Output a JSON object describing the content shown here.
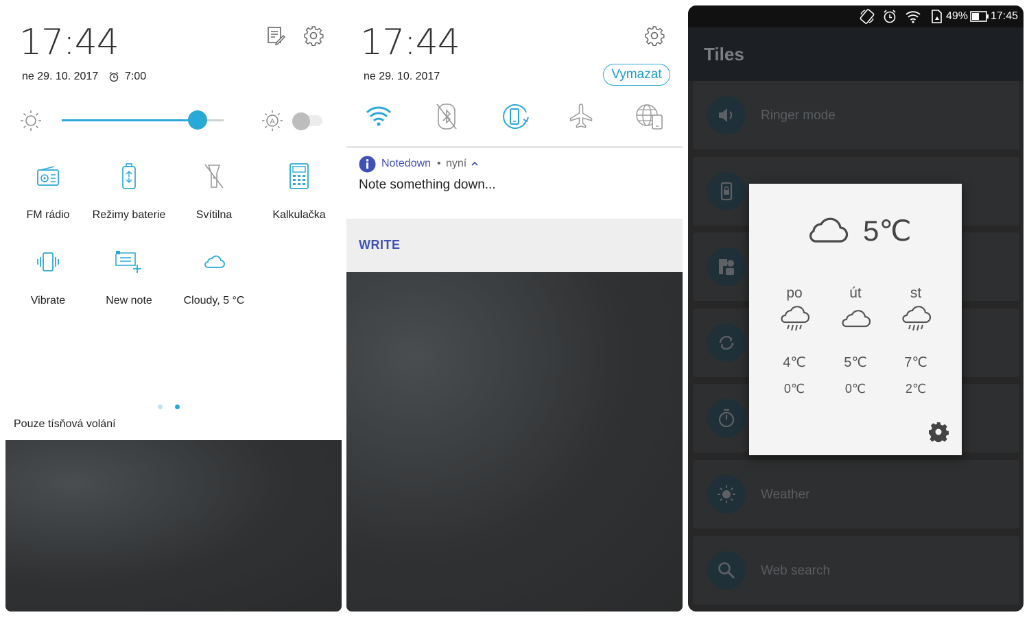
{
  "panel1": {
    "clock": "17:44",
    "date": "ne 29. 10. 2017",
    "alarm_time": "7:00",
    "brightness_percent": 84,
    "auto_brightness_on": false,
    "tiles": [
      {
        "label": "FM rádio",
        "icon": "radio-icon"
      },
      {
        "label": "Režimy baterie",
        "icon": "battery-mode-icon"
      },
      {
        "label": "Svítilna",
        "icon": "flashlight-off-icon"
      },
      {
        "label": "Kalkulačka",
        "icon": "calculator-icon"
      },
      {
        "label": "Vibrate",
        "icon": "vibrate-icon"
      },
      {
        "label": "New note",
        "icon": "new-note-icon"
      },
      {
        "label": "Cloudy, 5 °C",
        "icon": "cloud-icon"
      }
    ],
    "page_count": 2,
    "active_page": 2,
    "emergency_text": "Pouze tísňová volání"
  },
  "panel2": {
    "clock": "17:44",
    "date": "ne 29. 10. 2017",
    "clear_label": "Vymazat",
    "toggles": [
      "wifi-icon",
      "bluetooth-off-icon",
      "auto-rotate-icon",
      "airplane-mode-icon",
      "mobile-data-icon"
    ],
    "notification": {
      "app": "Notedown",
      "separator": "•",
      "time": "nyní",
      "text": "Note something down...",
      "action": "WRITE"
    }
  },
  "panel3": {
    "status": {
      "battery": "49%",
      "time": "17:45"
    },
    "title": "Tiles",
    "rows": [
      {
        "label": "Ringer mode",
        "icon": "volume-icon"
      },
      {
        "label": "",
        "icon": "lock-screen-icon"
      },
      {
        "label": "",
        "icon": "shapes-icon"
      },
      {
        "label": "",
        "icon": "sync-icon"
      },
      {
        "label": "",
        "icon": "timer-icon"
      },
      {
        "label": "Weather",
        "icon": "sun-icon"
      },
      {
        "label": "Web search",
        "icon": "search-icon"
      }
    ],
    "weather": {
      "current_temp": "5℃",
      "current_icon": "cloud-icon",
      "forecast": [
        {
          "day": "po",
          "icon": "rain-icon",
          "high": "4℃",
          "low": "0℃"
        },
        {
          "day": "út",
          "icon": "cloud-icon",
          "high": "5℃",
          "low": "0℃"
        },
        {
          "day": "st",
          "icon": "rain-icon",
          "high": "7℃",
          "low": "2℃"
        }
      ]
    }
  },
  "colors": {
    "accent": "#29a9d8",
    "notif_blue": "#3f51b5"
  }
}
